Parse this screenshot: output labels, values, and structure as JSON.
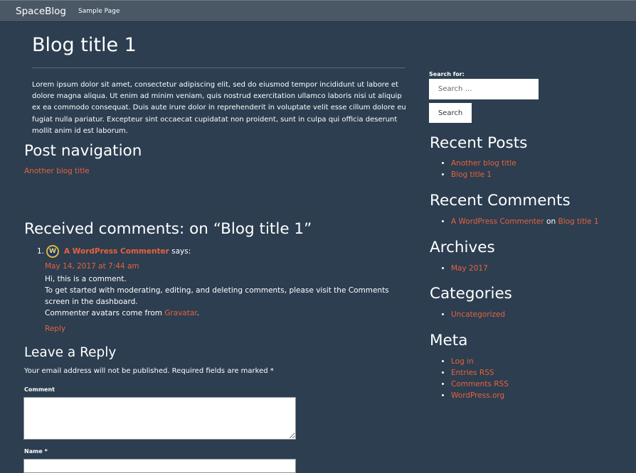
{
  "navbar": {
    "brand": "SpaceBlog",
    "links": [
      "Sample Page"
    ]
  },
  "post": {
    "title": "Blog title 1",
    "body": "Lorem ipsum dolor sit amet, consectetur adipiscing elit, sed do eiusmod tempor incididunt ut labore et dolore magna aliqua. Ut enim ad minim veniam, quis nostrud exercitation ullamco laboris nisi ut aliquip ex ea commodo consequat. Duis aute irure dolor in reprehenderit in voluptate velit esse cillum dolore eu fugiat nulla pariatur. Excepteur sint occaecat cupidatat non proident, sunt in culpa qui officia deserunt mollit anim id est laborum."
  },
  "post_navigation": {
    "heading": "Post navigation",
    "previous": "Another blog title"
  },
  "comments": {
    "heading": "Received comments: on “Blog title 1”",
    "items": [
      {
        "number": "1.",
        "avatar_icon": "wordpress-avatar-icon",
        "author": "A WordPress Commenter",
        "says": "says:",
        "date": "May 14, 2017 at 7:44 am",
        "line1": "Hi, this is a comment.",
        "line2": "To get started with moderating, editing, and deleting comments, please visit the Comments screen in the dashboard.",
        "line3_prefix": "Commenter avatars come from ",
        "line3_link": "Gravatar",
        "line3_suffix": ".",
        "reply": "Reply"
      }
    ]
  },
  "reply_form": {
    "heading": "Leave a Reply",
    "note": "Your email address will not be published. Required fields are marked *",
    "comment_label": "Comment",
    "name_label": "Name *"
  },
  "sidebar": {
    "search": {
      "label": "Search for:",
      "placeholder": "Search …",
      "button": "Search"
    },
    "recent_posts": {
      "title": "Recent Posts",
      "items": [
        "Another blog title",
        "Blog title 1"
      ]
    },
    "recent_comments": {
      "title": "Recent Comments",
      "author": "A WordPress Commenter",
      "on": "on",
      "post": "Blog title 1"
    },
    "archives": {
      "title": "Archives",
      "items": [
        "May 2017"
      ]
    },
    "categories": {
      "title": "Categories",
      "items": [
        "Uncategorized"
      ]
    },
    "meta": {
      "title": "Meta",
      "items": [
        "Log in",
        "Entries RSS",
        "Comments RSS",
        "WordPress.org"
      ]
    }
  },
  "colors": {
    "background": "#2c3e50",
    "navbar": "#4a5866",
    "link": "#e8613c",
    "text": "#ffffff"
  }
}
